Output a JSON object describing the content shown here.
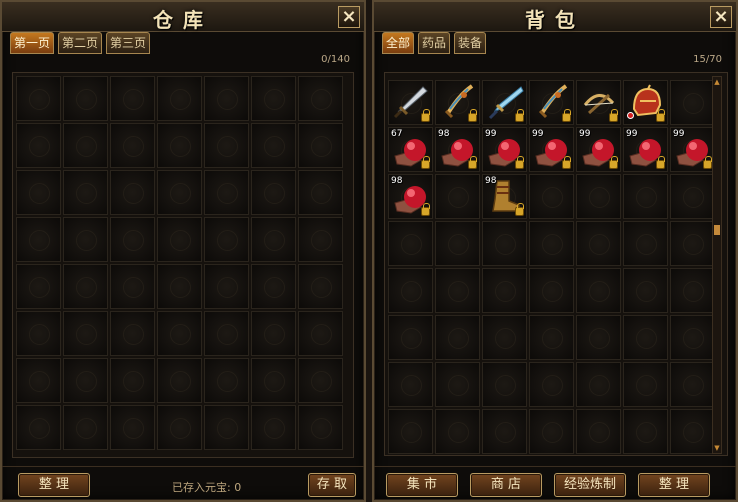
{
  "warehouse": {
    "title": "仓库",
    "tabs": [
      "第一页",
      "第二页",
      "第三页"
    ],
    "active_tab": 0,
    "count": "0/140",
    "stored_text": "已存入元宝: 0",
    "buttons": {
      "sort": "整 理",
      "deposit": "存 取"
    }
  },
  "bag": {
    "title": "背包",
    "tabs": [
      "全部",
      "药品",
      "装备"
    ],
    "active_tab": 0,
    "count": "15/70",
    "buttons": {
      "market": "集 市",
      "shop": "商 店",
      "exp_refine": "经验炼制",
      "sort": "整 理"
    },
    "items": [
      {
        "slot": 0,
        "icon": "sword-icon",
        "qty": ""
      },
      {
        "slot": 1,
        "icon": "dragon-blade-icon",
        "qty": ""
      },
      {
        "slot": 2,
        "icon": "ice-blade-icon",
        "qty": ""
      },
      {
        "slot": 3,
        "icon": "dragon-blade-icon",
        "qty": ""
      },
      {
        "slot": 4,
        "icon": "crossbow-icon",
        "qty": ""
      },
      {
        "slot": 5,
        "icon": "helmet-icon",
        "qty": ""
      },
      {
        "slot": 7,
        "icon": "red-orb-icon",
        "qty": "67"
      },
      {
        "slot": 8,
        "icon": "red-orb-icon",
        "qty": "98"
      },
      {
        "slot": 9,
        "icon": "red-orb-icon",
        "qty": "99"
      },
      {
        "slot": 10,
        "icon": "red-orb-icon",
        "qty": "99"
      },
      {
        "slot": 11,
        "icon": "red-orb-icon",
        "qty": "99"
      },
      {
        "slot": 12,
        "icon": "red-orb-icon",
        "qty": "99"
      },
      {
        "slot": 13,
        "icon": "red-orb-icon",
        "qty": "99"
      },
      {
        "slot": 14,
        "icon": "red-orb-icon",
        "qty": "98"
      },
      {
        "slot": 16,
        "icon": "boots-icon",
        "qty": "98"
      }
    ]
  },
  "colors": {
    "accent": "#c4781f",
    "border": "#5a4a33",
    "text": "#f3e3b8"
  }
}
